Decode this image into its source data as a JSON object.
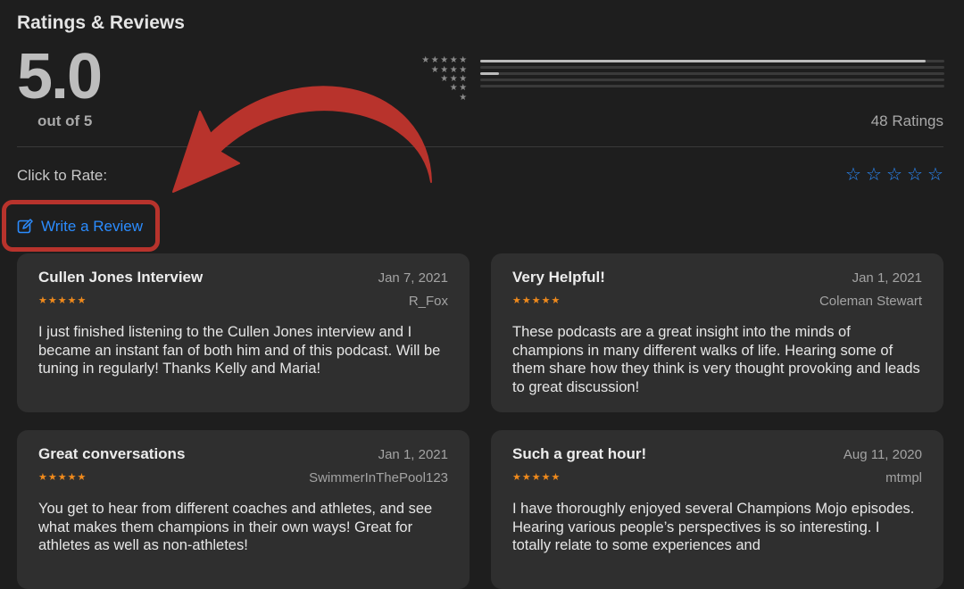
{
  "header": {
    "title": "Ratings & Reviews"
  },
  "summary": {
    "rating": "5.0",
    "out_of": "out of 5",
    "ratings_count": "48 Ratings",
    "distribution": [
      {
        "stars": 5,
        "fraction": 0.96
      },
      {
        "stars": 4,
        "fraction": 0.0
      },
      {
        "stars": 3,
        "fraction": 0.04
      },
      {
        "stars": 2,
        "fraction": 0.0
      },
      {
        "stars": 1,
        "fraction": 0.0
      }
    ]
  },
  "rate": {
    "label": "Click to Rate:",
    "stars": 5
  },
  "write_review": {
    "label": "Write a Review",
    "icon": "compose-icon"
  },
  "annotation": {
    "color": "#b8332c",
    "type": "arrow-and-box"
  },
  "colors": {
    "accent": "#2b8cff",
    "star": "#f08a1c",
    "card": "#2f2f2f",
    "background": "#1e1e1e"
  },
  "reviews": [
    {
      "title": "Cullen Jones Interview",
      "date": "Jan 7, 2021",
      "author": "R_Fox",
      "stars": "★★★★★",
      "body": "I just finished listening to the Cullen Jones interview and I became an instant fan of both him and of this podcast.  Will be tuning in regularly!  Thanks Kelly and Maria!"
    },
    {
      "title": "Very Helpful!",
      "date": "Jan 1, 2021",
      "author": "Coleman Stewart",
      "stars": "★★★★★",
      "body": "These podcasts are a great insight into the minds of champions in many different walks of life. Hearing some of them share how they think is very thought provoking and leads to great discussion!"
    },
    {
      "title": "Great conversations",
      "date": "Jan 1, 2021",
      "author": "SwimmerInThePool123",
      "stars": "★★★★★",
      "body": "You get to hear from different coaches and athletes, and see what makes them champions in their own ways! Great for athletes as well as non-athletes!"
    },
    {
      "title": "Such a great hour!",
      "date": "Aug 11, 2020",
      "author": "mtmpl",
      "stars": "★★★★★",
      "body": "I have thoroughly enjoyed several Champions Mojo episodes. Hearing various people’s perspectives is so interesting. I totally relate to some experiences and"
    }
  ]
}
